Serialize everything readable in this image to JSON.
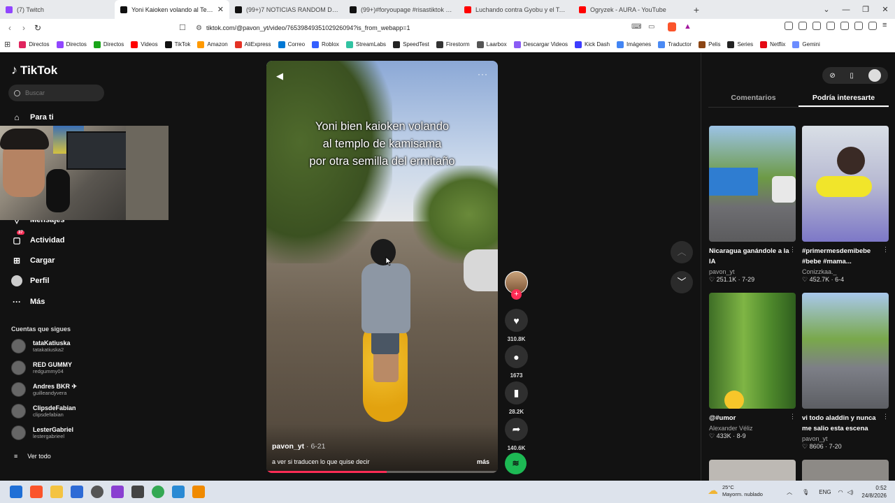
{
  "browser": {
    "tabs": [
      {
        "title": "(7) Twitch",
        "color": "#9146ff",
        "active": false
      },
      {
        "title": "Yoni Kaioken volando al Templo",
        "color": "#111111",
        "active": true
      },
      {
        "title": "(99+)7 NOTICIAS RANDOM DE HOY",
        "color": "#111111",
        "active": false
      },
      {
        "title": "(99+)#foryoupage #risastiktok #me",
        "color": "#111111",
        "active": false
      },
      {
        "title": "Luchando contra Gyobu y el Toro llam",
        "color": "#ff0000",
        "active": false
      },
      {
        "title": "Ogryzek - AURA - YouTube",
        "color": "#ff0000",
        "active": false
      }
    ],
    "new_tab": "+",
    "url": "tiktok.com/@pavon_yt/video/7653984935102926094?is_from_webapp=1",
    "bookmarks": [
      {
        "label": "Directos",
        "color": "#e0245e"
      },
      {
        "label": "Directos",
        "color": "#9146ff"
      },
      {
        "label": "Directos",
        "color": "#19a519"
      },
      {
        "label": "Videos",
        "color": "#ff0000"
      },
      {
        "label": "TikTok",
        "color": "#111111"
      },
      {
        "label": "Amazon",
        "color": "#ff9900"
      },
      {
        "label": "AliExpress",
        "color": "#e43225"
      },
      {
        "label": "Correo",
        "color": "#0078d4"
      },
      {
        "label": "Roblox",
        "color": "#335fff"
      },
      {
        "label": "StreamLabs",
        "color": "#31c3a2"
      },
      {
        "label": "SpeedTest",
        "color": "#222222"
      },
      {
        "label": "Firestorm",
        "color": "#333333"
      },
      {
        "label": "Laarbox",
        "color": "#555555"
      },
      {
        "label": "Descargar Videos",
        "color": "#8a5cf5"
      },
      {
        "label": "Kick Dash",
        "color": "#3d3dff"
      },
      {
        "label": "Imágenes",
        "color": "#4285f4"
      },
      {
        "label": "Traductor",
        "color": "#4a8af4"
      },
      {
        "label": "Pelis",
        "color": "#8b4513"
      },
      {
        "label": "Series",
        "color": "#222222"
      },
      {
        "label": "Netflix",
        "color": "#e50914"
      },
      {
        "label": "Gemini",
        "color": "#6b8cff"
      }
    ]
  },
  "sidebar": {
    "logo": "TikTok",
    "search_placeholder": "Buscar",
    "nav": [
      {
        "label": "Para ti",
        "icon": "home-icon"
      },
      {
        "label": "Mensajes",
        "icon": "message-icon"
      },
      {
        "label": "Actividad",
        "icon": "activity-icon",
        "badge": "37"
      },
      {
        "label": "Cargar",
        "icon": "upload-icon"
      },
      {
        "label": "Perfil",
        "icon": "profile-icon"
      },
      {
        "label": "Más",
        "icon": "more-icon"
      }
    ],
    "following_title": "Cuentas que sigues",
    "following": [
      {
        "name": "tataKatiuska",
        "handle": "tatakatiuska2"
      },
      {
        "name": "RED GUMMY",
        "handle": "redgummy04"
      },
      {
        "name": "Andres BKR ✈",
        "handle": "guilleandyvera"
      },
      {
        "name": "ClipsdeFabian",
        "handle": "clipsdefabian"
      },
      {
        "name": "LesterGabriel",
        "handle": "lestergabrieel"
      }
    ],
    "see_all": "Ver todo"
  },
  "video": {
    "caption_lines": [
      "Yoni bien kaioken volando",
      "al templo de kamisama",
      "por otra semilla del ermitaño"
    ],
    "author": "pavon_yt",
    "date": "6-21",
    "description": "a ver si traducen lo que quise decir",
    "more": "más",
    "progress": 0.52
  },
  "actions": {
    "likes": "310.8K",
    "comments": "1673",
    "saves": "28.2K",
    "shares": "140.6K"
  },
  "right_panel": {
    "tabs": [
      "Comentarios",
      "Podría interesarte"
    ],
    "cards": [
      {
        "title": "Nicaragua ganándole a la IA",
        "user": "pavon_yt",
        "views": "251.1K",
        "date": "7-29"
      },
      {
        "title": "#primermesdemibebe #bebe #mama...",
        "user": "Conizzkaa._",
        "views": "452.7K",
        "date": "6-4"
      },
      {
        "title": "@#umor",
        "user": "Alexander Véliz",
        "views": "433K",
        "date": "8-9"
      },
      {
        "title": "vi todo aladdin y nunca me salio esta escena",
        "user": "pavon_yt",
        "views": "8606",
        "date": "7-20"
      }
    ]
  },
  "taskbar": {
    "weather_temp": "25°C",
    "weather_desc": "Mayorm. nublado",
    "lang": "ENG",
    "time": "0:52",
    "date": "24/8/2026"
  }
}
